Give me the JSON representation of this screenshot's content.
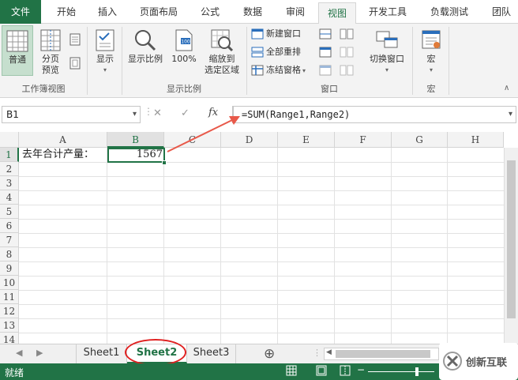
{
  "ribbon_tabs": [
    "文件",
    "开始",
    "插入",
    "页面布局",
    "公式",
    "数据",
    "审阅",
    "视图",
    "开发工具",
    "负载测试",
    "团队"
  ],
  "active_tab": "视图",
  "ribbon": {
    "workbook_views": {
      "normal": "普通",
      "page_break_line1": "分页",
      "page_break_line2": "预览",
      "group_label": "工作簿视图"
    },
    "show": {
      "label": "显示"
    },
    "zoom": {
      "zoom_label": "显示比例",
      "zoom100": "100%",
      "zoom_sel_line1": "缩放到",
      "zoom_sel_line2": "选定区域",
      "group_label": "显示比例"
    },
    "window": {
      "new_window": "新建窗口",
      "arrange_all": "全部重排",
      "freeze_panes": "冻结窗格",
      "switch_windows": "切换窗口",
      "group_label": "窗口"
    },
    "macros": {
      "label": "宏",
      "group_label": "宏"
    }
  },
  "formula_bar": {
    "name_box": "B1",
    "cancel": "✕",
    "enter": "✓",
    "fx": "fx",
    "formula": "=SUM(Range1,Range2)"
  },
  "grid": {
    "columns": [
      "A",
      "B",
      "C",
      "D",
      "E",
      "F",
      "G",
      "H"
    ],
    "rows": [
      "1",
      "2",
      "3",
      "4",
      "5",
      "6",
      "7",
      "8",
      "9",
      "10",
      "11",
      "12",
      "13",
      "14"
    ],
    "cells": {
      "A1": "去年合计产量：",
      "B1": "1567"
    },
    "selected_cell": "B1"
  },
  "sheets": {
    "tabs": [
      "Sheet1",
      "Sheet2",
      "Sheet3"
    ],
    "active": "Sheet2",
    "add_label": "⊕"
  },
  "status": {
    "text": "就绪",
    "watermark": "创新互联"
  },
  "colors": {
    "accent": "#217346",
    "annotation": "#e02020"
  }
}
